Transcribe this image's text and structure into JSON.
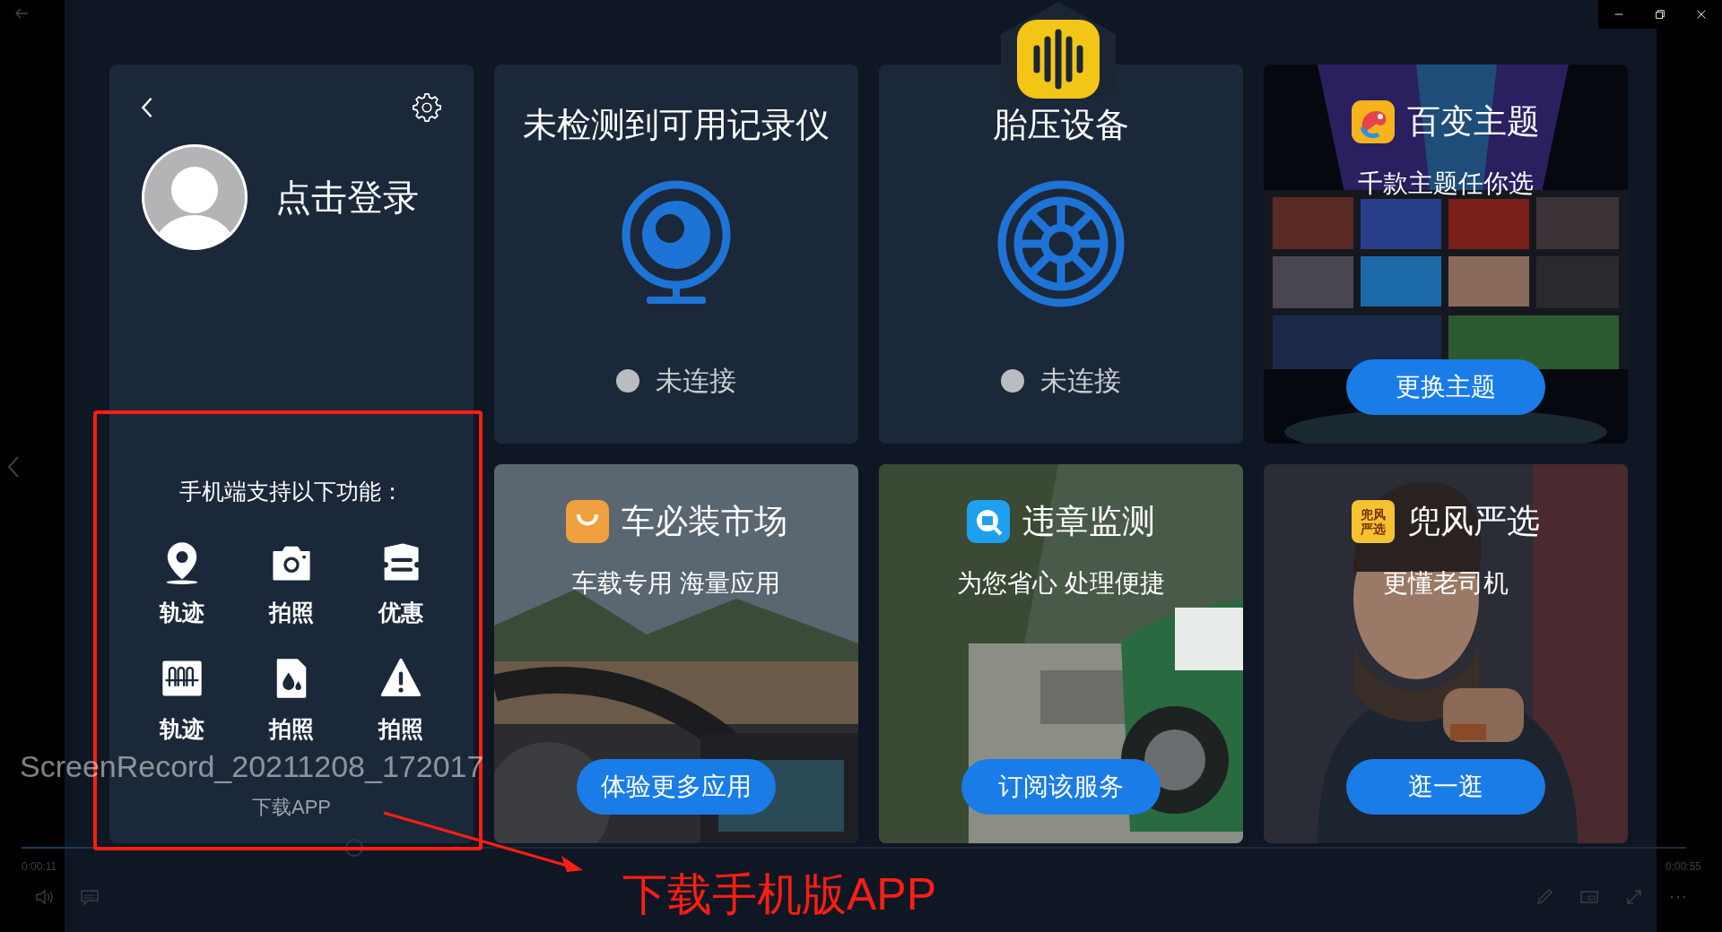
{
  "window_controls": [
    {
      "kind": "minimize"
    },
    {
      "kind": "restore"
    },
    {
      "kind": "close"
    }
  ],
  "account": {
    "login_label": "点击登录"
  },
  "app_promo": {
    "heading": "手机端支持以下功能：",
    "download_label": "下载APP",
    "features": [
      {
        "kind": "pin",
        "label": "轨迹"
      },
      {
        "kind": "camera",
        "label": "拍照"
      },
      {
        "kind": "coupon",
        "label": "优惠"
      },
      {
        "kind": "barrier",
        "label": "轨迹"
      },
      {
        "kind": "drops",
        "label": "拍照"
      },
      {
        "kind": "warning",
        "label": "拍照"
      }
    ]
  },
  "devices": [
    {
      "kind": "recorder",
      "title": "未检测到可用记录仪",
      "status": "未连接",
      "connected": false
    },
    {
      "kind": "tire",
      "title": "胎压设备",
      "status": "未连接",
      "connected": false
    }
  ],
  "promos": [
    {
      "kind": "theme",
      "title": "百变主题",
      "subtitle": "千款主题任你选",
      "button": "更换主题"
    },
    {
      "kind": "market",
      "title": "车必装市场",
      "subtitle": "车载专用 海量应用",
      "button": "体验更多应用"
    },
    {
      "kind": "violation",
      "title": "违章监测",
      "subtitle": "为您省心 处理便捷",
      "button": "订阅该服务"
    },
    {
      "kind": "style",
      "title": "兜风严选",
      "subtitle": "更懂老司机",
      "button": "逛一逛",
      "logo_lines": [
        "兜风",
        "严选"
      ]
    }
  ],
  "player": {
    "title": "ScreenRecord_20211208_172017",
    "elapsed": "0:00:11",
    "duration": "0:00:55",
    "level": 0.2
  },
  "annotation": {
    "caption": "下载手机版APP"
  }
}
